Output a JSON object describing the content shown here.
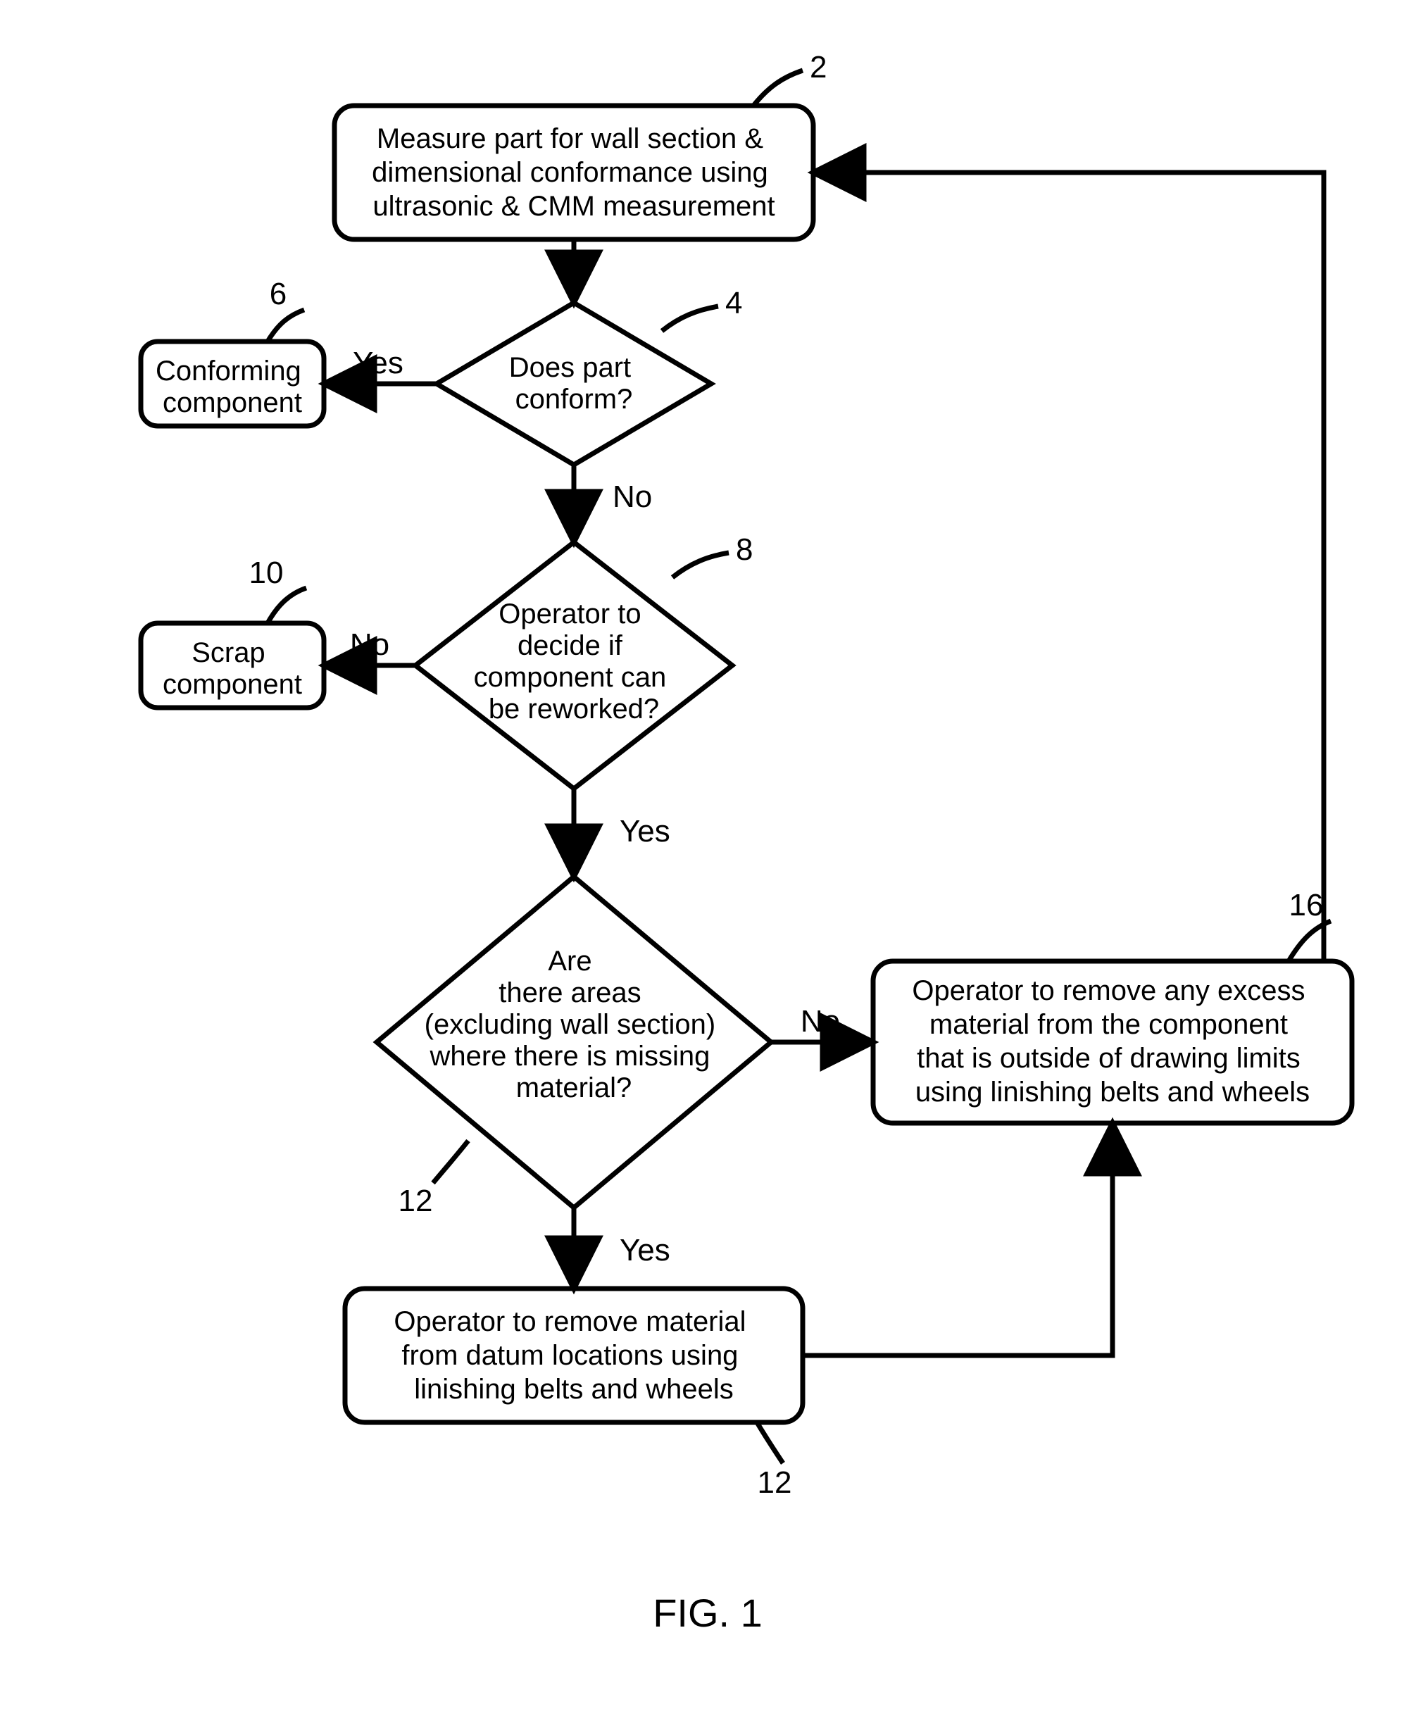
{
  "figure_label": "FIG. 1",
  "nodes": {
    "n2": {
      "ref": "2",
      "lines": [
        "Measure part for wall section &",
        "dimensional conformance using",
        "ultrasonic & CMM measurement"
      ]
    },
    "n4": {
      "ref": "4",
      "lines": [
        "Does part",
        "conform?"
      ],
      "yes": "Yes",
      "no": "No"
    },
    "n6": {
      "ref": "6",
      "lines": [
        "Conforming",
        "component"
      ]
    },
    "n8": {
      "ref": "8",
      "lines": [
        "Operator to",
        "decide if",
        "component can",
        "be reworked?"
      ],
      "yes": "Yes",
      "no": "No"
    },
    "n10": {
      "ref": "10",
      "lines": [
        "Scrap",
        "component"
      ]
    },
    "n12d": {
      "ref": "12",
      "lines": [
        "Are",
        "there areas",
        "(excluding wall section)",
        "where there is missing",
        "material?"
      ],
      "yes": "Yes",
      "no": "No"
    },
    "n12b": {
      "ref": "12",
      "lines": [
        "Operator to remove material",
        "from datum locations using",
        "linishing belts and wheels"
      ]
    },
    "n16": {
      "ref": "16",
      "lines": [
        "Operator to remove any excess",
        "material from the component",
        "that is outside of drawing limits",
        "using linishing belts and wheels"
      ]
    }
  },
  "chart_data": {
    "type": "flowchart",
    "nodes": [
      {
        "id": "2",
        "kind": "process",
        "text": "Measure part for wall section & dimensional conformance using ultrasonic & CMM measurement"
      },
      {
        "id": "4",
        "kind": "decision",
        "text": "Does part conform?"
      },
      {
        "id": "6",
        "kind": "terminal",
        "text": "Conforming component"
      },
      {
        "id": "8",
        "kind": "decision",
        "text": "Operator to decide if component can be reworked?"
      },
      {
        "id": "10",
        "kind": "terminal",
        "text": "Scrap component"
      },
      {
        "id": "12d",
        "kind": "decision",
        "text": "Are there areas (excluding wall section) where there is missing material?",
        "ref": "12"
      },
      {
        "id": "12b",
        "kind": "process",
        "text": "Operator to remove material from datum locations using linishing belts and wheels",
        "ref": "12"
      },
      {
        "id": "16",
        "kind": "process",
        "text": "Operator to remove any excess material from the component that is outside of drawing limits using linishing belts and wheels"
      }
    ],
    "edges": [
      {
        "from": "2",
        "to": "4",
        "label": ""
      },
      {
        "from": "4",
        "to": "6",
        "label": "Yes"
      },
      {
        "from": "4",
        "to": "8",
        "label": "No"
      },
      {
        "from": "8",
        "to": "10",
        "label": "No"
      },
      {
        "from": "8",
        "to": "12d",
        "label": "Yes"
      },
      {
        "from": "12d",
        "to": "16",
        "label": "No"
      },
      {
        "from": "12d",
        "to": "12b",
        "label": "Yes"
      },
      {
        "from": "12b",
        "to": "16",
        "label": ""
      },
      {
        "from": "16",
        "to": "2",
        "label": ""
      }
    ]
  }
}
